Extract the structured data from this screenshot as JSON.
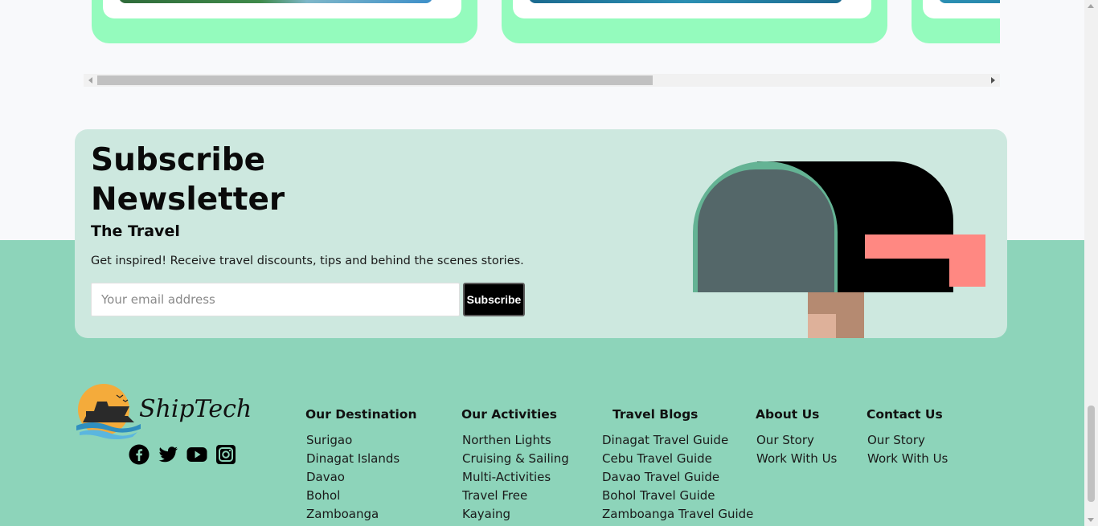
{
  "carousel": {
    "cards": [
      {
        "image": "green-coast"
      },
      {
        "image": "blue-sea"
      },
      {
        "image": "blue-sea"
      }
    ]
  },
  "newsletter": {
    "title": "Subscribe Newsletter",
    "subtitle": "The Travel",
    "description": "Get inspired! Receive travel discounts, tips and behind the scenes stories.",
    "email_placeholder": "Your email address",
    "subscribe_label": "Subscribe"
  },
  "brand": {
    "name": "ShipTech"
  },
  "socials": [
    "facebook-icon",
    "twitter-icon",
    "youtube-icon",
    "instagram-icon"
  ],
  "footer": {
    "columns": [
      {
        "title": "Our Destination",
        "links": [
          "Surigao",
          "Dinagat Islands",
          "Davao",
          "Bohol",
          "Zamboanga"
        ]
      },
      {
        "title": "Our Activities",
        "links": [
          "Northen Lights",
          "Cruising & Sailing",
          "Multi-Activities",
          "Travel Free",
          "Kayaing"
        ]
      },
      {
        "title": "Travel Blogs",
        "links": [
          "Dinagat Travel Guide",
          "Cebu Travel Guide",
          "Davao Travel Guide",
          "Bohol Travel Guide",
          "Zamboanga Travel Guide"
        ]
      },
      {
        "title": "About Us",
        "links": [
          "Our Story",
          "Work With Us"
        ]
      },
      {
        "title": "Contact Us",
        "links": [
          "Our Story",
          "Work With Us"
        ]
      }
    ]
  },
  "colors": {
    "footer_bg": "#8dd4ba",
    "card_bg": "#94fbbd",
    "newsletter_bg": "#cde8df",
    "mailbox_flag": "#ff8882"
  }
}
